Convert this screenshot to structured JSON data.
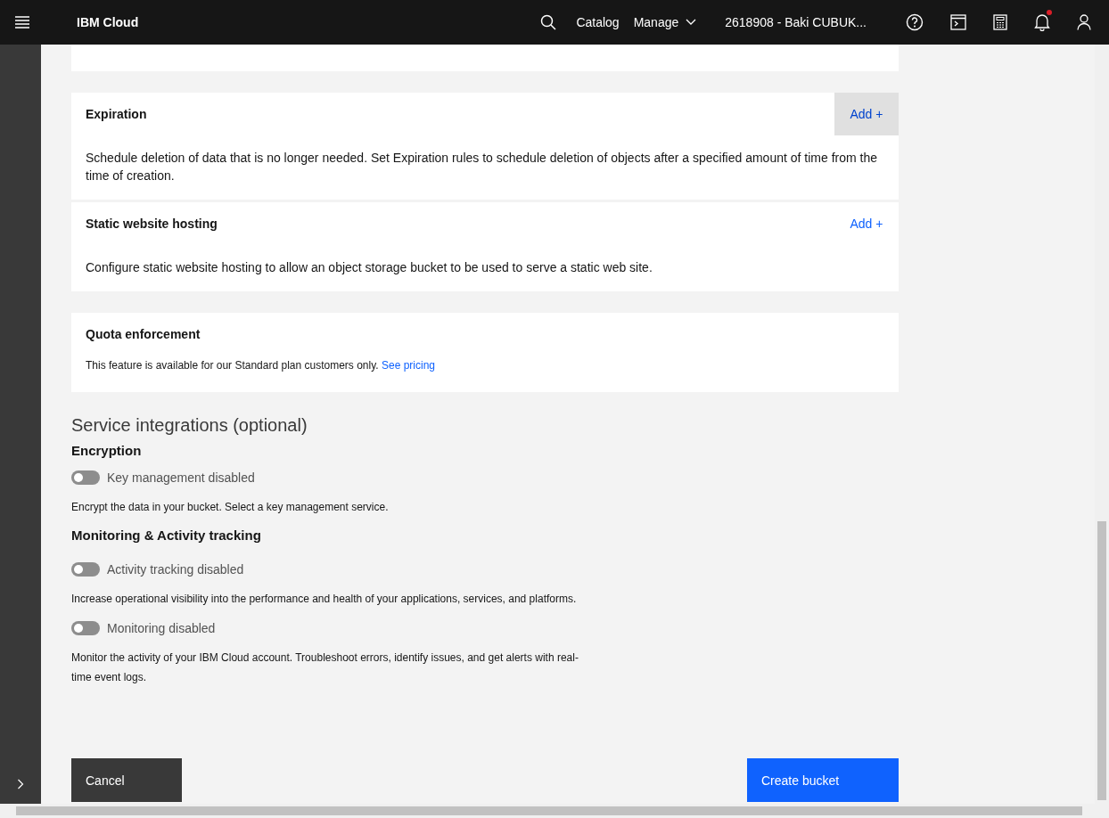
{
  "header": {
    "brand": "IBM Cloud",
    "nav": [
      {
        "label": "Catalog",
        "dropdown": false
      },
      {
        "label": "Manage",
        "dropdown": true
      }
    ],
    "account": "2618908 - Baki CUBUK...",
    "notification_unread": true
  },
  "cards": [
    {
      "title": "Expiration",
      "action": "Add +",
      "highlighted": true,
      "description": "Schedule deletion of data that is no longer needed. Set Expiration rules to schedule deletion of objects after a specified amount of time from the time of creation."
    },
    {
      "title": "Static website hosting",
      "action": "Add +",
      "highlighted": false,
      "description": "Configure static website hosting to allow an object storage bucket to be used to serve a static web site."
    }
  ],
  "quota": {
    "title": "Quota enforcement",
    "note": "This feature is available for our Standard plan customers only.",
    "link": "See pricing"
  },
  "integrations": {
    "title": "Service integrations (optional)",
    "groups": [
      {
        "heading": "Encryption",
        "toggles": [
          {
            "label": "Key management disabled",
            "on": false,
            "description": "Encrypt the data in your bucket. Select a key management service."
          }
        ]
      },
      {
        "heading": "Monitoring & Activity tracking",
        "toggles": [
          {
            "label": "Activity tracking disabled",
            "on": false,
            "description": "Increase operational visibility into the performance and health of your applications, services, and platforms."
          },
          {
            "label": "Monitoring disabled",
            "on": false,
            "description": "Monitor the activity of your IBM Cloud account. Troubleshoot errors, identify issues, and get alerts with real-time event logs."
          }
        ]
      }
    ]
  },
  "buttons": {
    "cancel": "Cancel",
    "create": "Create bucket"
  }
}
